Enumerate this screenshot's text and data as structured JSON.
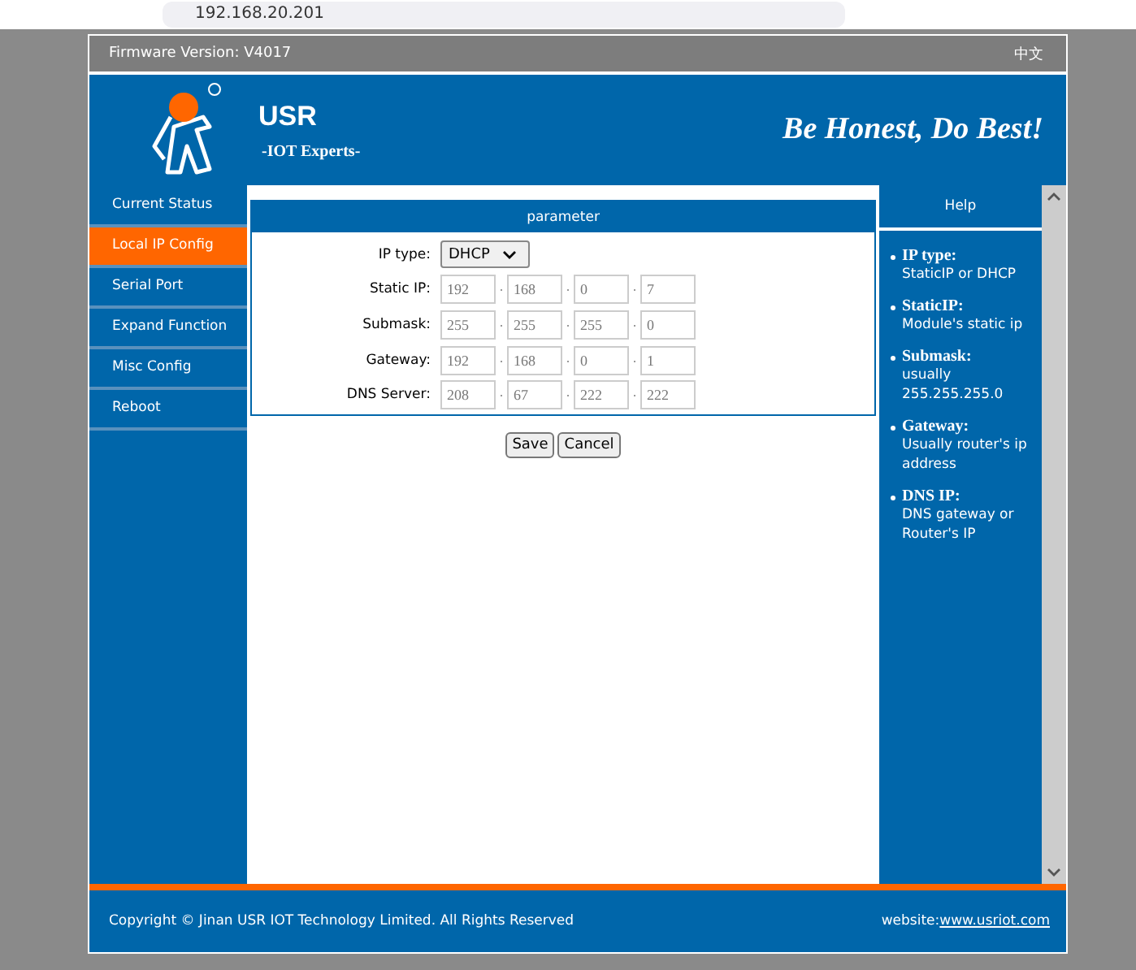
{
  "browser": {
    "address": "192.168.20.201"
  },
  "top_bar": {
    "firmware": "Firmware Version:  V4017",
    "language": "中文"
  },
  "header": {
    "brand": "USR",
    "tagline": "-IOT Experts-",
    "slogan": "Be Honest, Do Best!"
  },
  "sidebar": {
    "items": [
      {
        "label": "Current Status",
        "selected": false
      },
      {
        "label": "Local IP Config",
        "selected": true
      },
      {
        "label": "Serial Port",
        "selected": false
      },
      {
        "label": "Expand Function",
        "selected": false
      },
      {
        "label": "Misc Config",
        "selected": false
      },
      {
        "label": "Reboot",
        "selected": false
      }
    ]
  },
  "form": {
    "title": "parameter",
    "ip_type": {
      "label": "IP type:",
      "value": "DHCP"
    },
    "rows": [
      {
        "label": "Static IP:",
        "octets": [
          "192",
          "168",
          "0",
          "7"
        ]
      },
      {
        "label": "Submask:",
        "octets": [
          "255",
          "255",
          "255",
          "0"
        ]
      },
      {
        "label": "Gateway:",
        "octets": [
          "192",
          "168",
          "0",
          "1"
        ]
      },
      {
        "label": "DNS Server:",
        "octets": [
          "208",
          "67",
          "222",
          "222"
        ]
      }
    ],
    "buttons": [
      "Save",
      "Cancel"
    ]
  },
  "help": {
    "title": "Help",
    "items": [
      {
        "term": "IP type:",
        "text": "StaticIP or DHCP"
      },
      {
        "term": "StaticIP:",
        "text": "Module's static ip"
      },
      {
        "term": "Submask:",
        "text": "usually 255.255.255.0"
      },
      {
        "term": "Gateway:",
        "text": "Usually router's ip address"
      },
      {
        "term": "DNS IP:",
        "text": "DNS gateway or Router's IP"
      }
    ]
  },
  "footer": {
    "copyright": "Copyright © Jinan USR IOT Technology Limited. All Rights Reserved",
    "website_label": "website:",
    "website_link": "www.usriot.com"
  }
}
